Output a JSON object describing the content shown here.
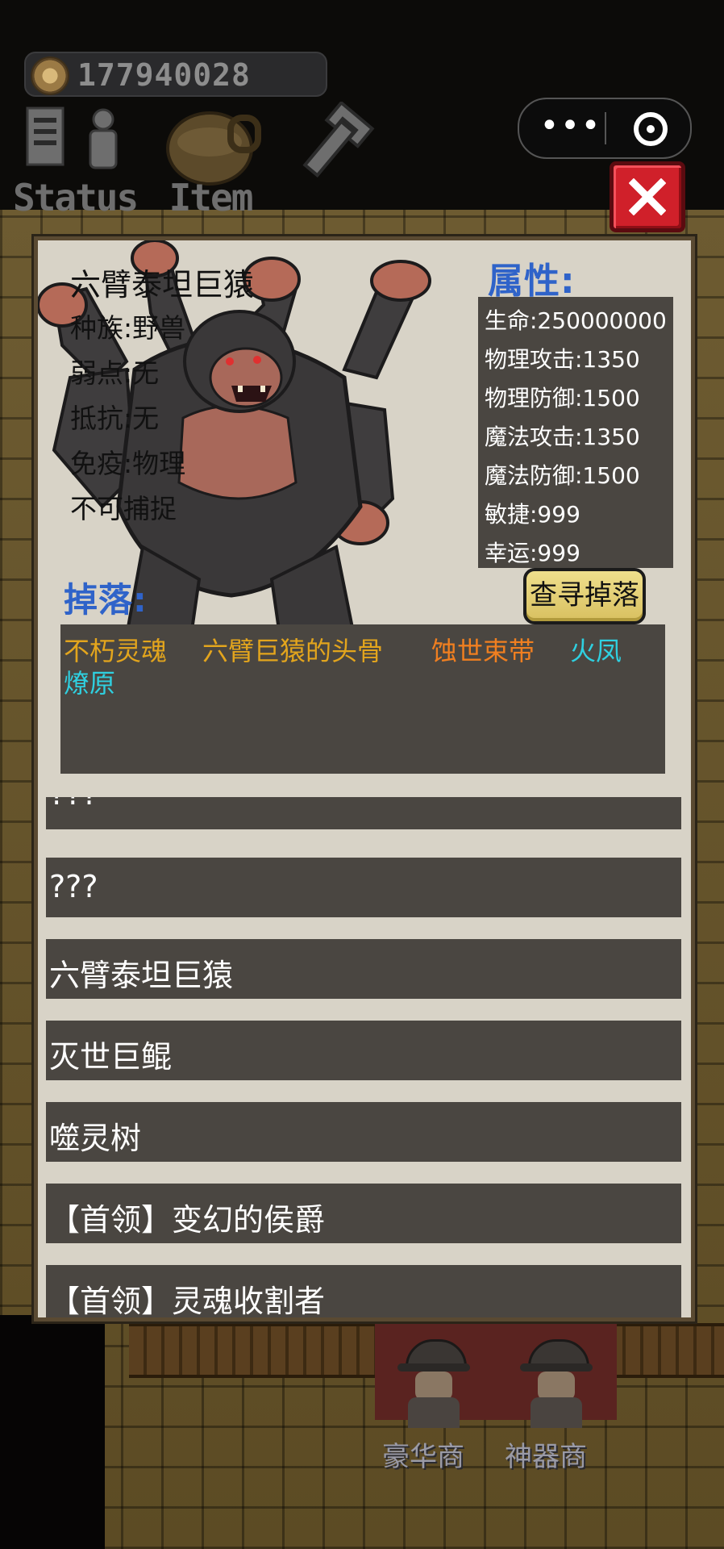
{
  "hud": {
    "coins": "177940028",
    "status_label": "Status",
    "item_label": "Item"
  },
  "panel": {
    "monster_name": "六臂泰坦巨猿",
    "info": [
      "种族:野兽",
      "弱点:无",
      "抵抗:无",
      "免疫:物理",
      "不可捕捉"
    ],
    "attributes_title": "属性:",
    "attributes": [
      "生命:250000000",
      "物理攻击:1350",
      "物理防御:1500",
      "魔法攻击:1350",
      "魔法防御:1500",
      "敏捷:999",
      "幸运:999"
    ],
    "drops_title": "掉落:",
    "find_drops_label": "查寻掉落",
    "drops": [
      {
        "name": "不朽灵魂",
        "color": "#e3a51d"
      },
      {
        "name": "六臂巨猿的头骨",
        "color": "#e3a51d"
      },
      {
        "name": "蚀世束带",
        "color": "#f07f20"
      },
      {
        "name": "火凤",
        "color": "#2fd0e0"
      },
      {
        "name": "燎原",
        "color": "#2fd0e0"
      }
    ],
    "monster_list": [
      "???",
      "???",
      "六臂泰坦巨猿",
      "灭世巨鲲",
      "噬灵树",
      "【首领】变幻的侯爵",
      "【首领】灵魂收割者"
    ]
  },
  "shops": {
    "luxury_label": "豪华商",
    "artifact_label": "神器商"
  },
  "icons": {
    "coin": "coin-icon",
    "status": "status-icon",
    "item": "bag-icon",
    "settings": "wrench-icon",
    "more": "more-icon",
    "capsule_close": "target-icon",
    "close": "close-icon"
  },
  "colors": {
    "title_blue": "#2f63c9",
    "panel_bg": "#d8d3c7",
    "box_bg": "#4a4641",
    "close_red": "#d0202a",
    "button_yellow": "#e4d275"
  }
}
